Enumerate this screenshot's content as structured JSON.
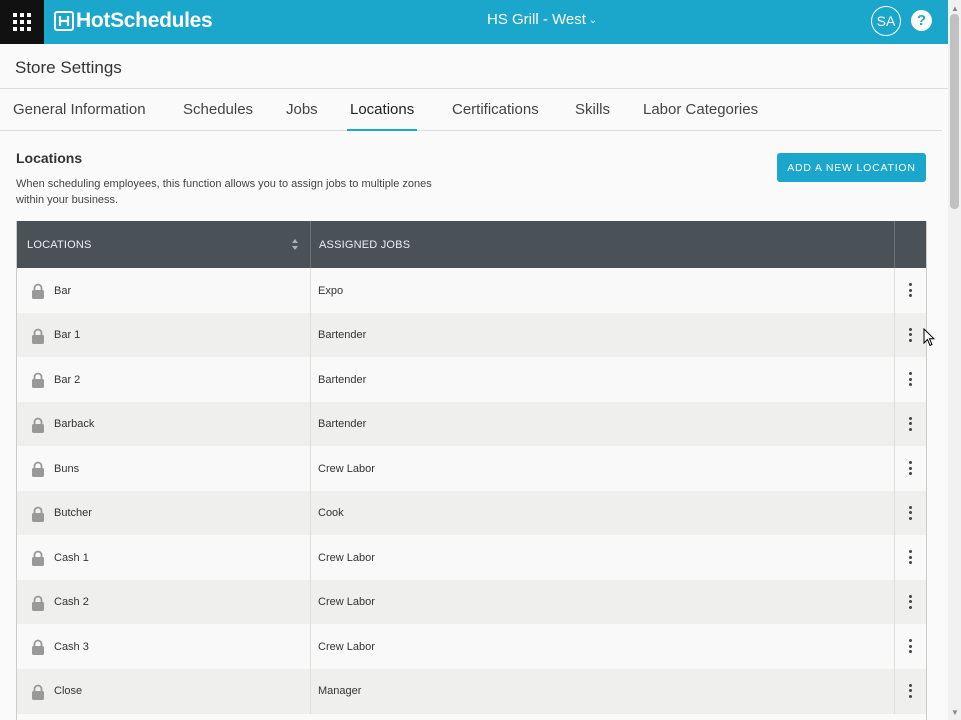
{
  "topbar": {
    "app_menu_icon": "app-grid-icon",
    "brand": "HotSchedules",
    "store": "HS Grill - West",
    "store_chevron": "⌄",
    "user_initials": "SA",
    "help": "?"
  },
  "page": {
    "title": "Store Settings"
  },
  "tabs": [
    {
      "label": "General Information"
    },
    {
      "label": "Schedules"
    },
    {
      "label": "Jobs"
    },
    {
      "label": "Locations",
      "active": true
    },
    {
      "label": "Certifications"
    },
    {
      "label": "Skills"
    },
    {
      "label": "Labor Categories"
    }
  ],
  "section": {
    "title": "Locations",
    "description": "When scheduling employees, this function allows you to assign jobs to multiple zones within your business.",
    "add_button": "ADD A NEW LOCATION"
  },
  "table": {
    "columns": [
      "LOCATIONS",
      "ASSIGNED JOBS"
    ],
    "rows": [
      {
        "location": "Bar",
        "job": "Expo"
      },
      {
        "location": "Bar 1",
        "job": "Bartender"
      },
      {
        "location": "Bar 2",
        "job": "Bartender"
      },
      {
        "location": "Barback",
        "job": "Bartender"
      },
      {
        "location": "Buns",
        "job": "Crew Labor"
      },
      {
        "location": "Butcher",
        "job": "Cook"
      },
      {
        "location": "Cash 1",
        "job": "Crew Labor"
      },
      {
        "location": "Cash 2",
        "job": "Crew Labor"
      },
      {
        "location": "Cash 3",
        "job": "Crew Labor"
      },
      {
        "location": "Close",
        "job": "Manager"
      }
    ]
  },
  "colors": {
    "brand": "#1ba6cb",
    "header_dark": "#4a5257",
    "row_odd": "#f9f9f9",
    "row_even": "#efefee"
  }
}
